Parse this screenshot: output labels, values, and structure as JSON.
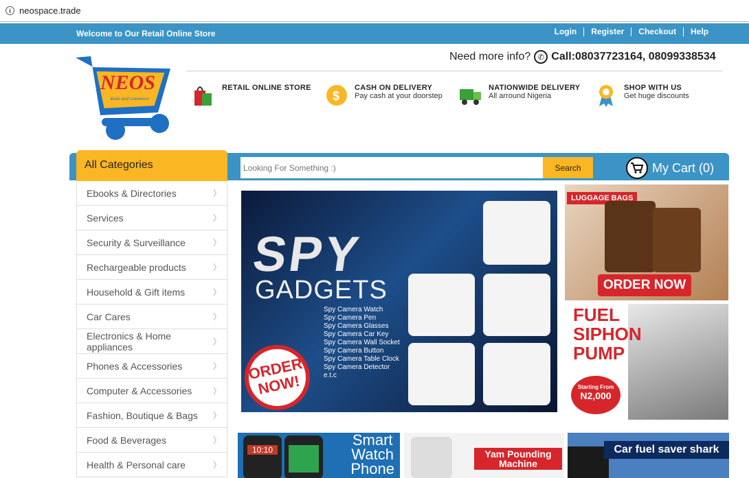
{
  "browser": {
    "url": "neospace.trade"
  },
  "topbar": {
    "welcome": "Welcome to Our Retail Online Store",
    "links": [
      "Login",
      "Register",
      "Checkout",
      "Help"
    ]
  },
  "header": {
    "info_label": "Need more info?",
    "call": "Call:08037723164, 08099338534",
    "features": [
      {
        "title": "RETAIL ONLINE STORE",
        "sub": ""
      },
      {
        "title": "CASH ON DELIVERY",
        "sub": "Pay cash at your doorstep"
      },
      {
        "title": "NATIONWIDE DELIVERY",
        "sub": "All arround Nigeria"
      },
      {
        "title": "SHOP WITH US",
        "sub": "Get huge discounts"
      }
    ]
  },
  "nav": {
    "all_categories": "All Categories",
    "search_placeholder": "Looking For Something :)",
    "search_button": "Search",
    "cart": "My Cart (0)"
  },
  "categories": [
    "Ebooks & Directories",
    "Services",
    "Security & Surveillance",
    "Rechargeable products",
    "Household & Gift items",
    "Car Cares",
    "Electronics & Home appliances",
    "Phones & Accessories",
    "Computer & Accessories",
    "Fashion, Boutique & Bags",
    "Food & Beverages",
    "Health & Personal care"
  ],
  "banner": {
    "headline": "SPY",
    "sub": "GADGETS",
    "items": [
      "Spy Camera Watch",
      "Spy Camera Pen",
      "Spy Camera Glasses",
      "Spy Camera Car Key",
      "Spy Camera Wall Socket",
      "Spy Camera Button",
      "Spy Camera Table Clock",
      "Spy Camera Detector",
      "e.t.c"
    ],
    "order_line1": "ORDER",
    "order_line2": "NOW!"
  },
  "promo_luggage": {
    "label": "LUGGAGE BAGS",
    "cta": "ORDER NOW"
  },
  "promo_fuel": {
    "title_1": "FUEL",
    "title_2": "SIPHON",
    "title_3": "PUMP",
    "price_label": "Starting From",
    "price": "N2,000"
  },
  "promo_watch": {
    "line1": "Smart",
    "line2": "Watch",
    "line3": "Phone",
    "screen1": "10:10"
  },
  "promo_yam": {
    "line1": "Yam Pounding",
    "line2": "Machine"
  },
  "promo_car": {
    "text": "Car fuel saver shark"
  },
  "colors": {
    "primary": "#3b94c5",
    "accent": "#fbb623",
    "red": "#d6262b"
  }
}
